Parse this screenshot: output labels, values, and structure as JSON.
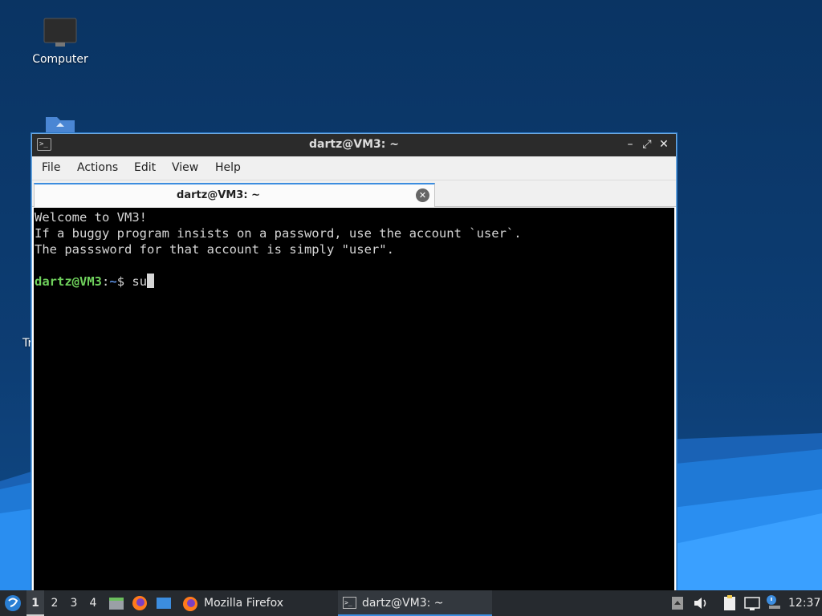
{
  "desktop": {
    "icons": [
      {
        "label": "Computer",
        "icon": "monitor-icon"
      },
      {
        "label": "",
        "icon": "folder-icon"
      },
      {
        "label": "Tr",
        "icon": "trash-icon"
      }
    ]
  },
  "window": {
    "title": "dartz@VM3: ~",
    "controls": {
      "minimize": "–",
      "restore": "⤢",
      "close": "✕"
    },
    "menu": [
      "File",
      "Actions",
      "Edit",
      "View",
      "Help"
    ],
    "tab": {
      "label": "dartz@VM3: ~",
      "close": "✕"
    }
  },
  "terminal": {
    "lines": [
      "Welcome to VM3!",
      "If a buggy program insists on a password, use the account `user`.",
      "The passsword for that account is simply \"user\".",
      ""
    ],
    "prompt": {
      "user_host": "dartz@VM3",
      "sep": ":",
      "path": "~",
      "symbol": "$ ",
      "input": "su"
    }
  },
  "taskbar": {
    "workspaces": [
      "1",
      "2",
      "3",
      "4"
    ],
    "active_workspace": "1",
    "launchers": [
      "file-manager-icon",
      "firefox-icon",
      "desktop-icon"
    ],
    "tasks": [
      {
        "label": "Mozilla Firefox",
        "icon": "firefox-icon",
        "active": false
      },
      {
        "label": "dartz@VM3: ~",
        "icon": "terminal-icon",
        "active": true
      }
    ],
    "tray": [
      "eject-icon",
      "volume-icon",
      "clipboard-icon",
      "network-icon",
      "notification-icon"
    ],
    "clock": "12:37"
  },
  "colors": {
    "accent": "#3c8ddf",
    "prompt_user": "#6fd15c",
    "prompt_path": "#5b8fe0",
    "taskbar_bg": "#262a2f"
  }
}
